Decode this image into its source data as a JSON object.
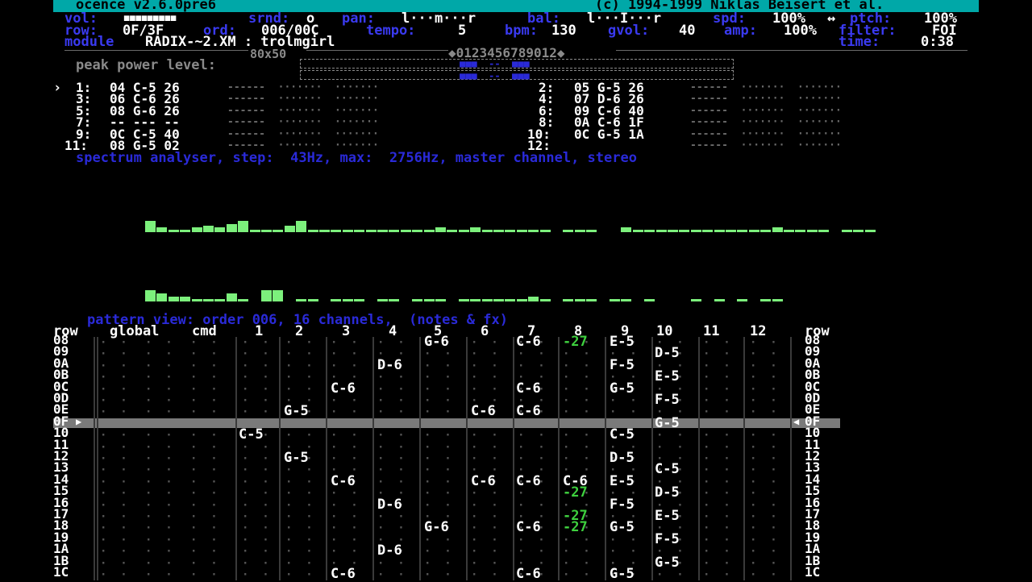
{
  "title": {
    "app": "ocence v2.6.0pre6",
    "copyright": "(c) 1994-1999 Niklas Beisert et al."
  },
  "status": {
    "vol_label": "vol:",
    "vol_value": "▪▪▪▪▪▪▪▪▪",
    "srnd_label": "srnd:",
    "srnd_value": "o",
    "pan_label": "pan:",
    "pan_value": "l···m···r",
    "bal_label": "bal:",
    "bal_value": "l···I···r",
    "spd_label": "spd:",
    "spd_value": "100%",
    "ptch_label": "ptch:",
    "ptch_value": "100%",
    "row_label": "row:",
    "row_value": "0F/3F",
    "ord_label": "ord:",
    "ord_value": "006/00C",
    "tempo_label": "tempo:",
    "tempo_value": "5",
    "bpm_label": "bpm:",
    "bpm_value": "130",
    "gvol_label": "gvol:",
    "gvol_value": "40",
    "amp_label": "amp:",
    "amp_value": "100%",
    "filter_label": "filter:",
    "filter_value": "FOI",
    "module_label": "module",
    "module_value": "RADIX-~2.XM : trolmgirl",
    "time_label": "time:",
    "time_value": "0:38"
  },
  "mode_box": "80x50",
  "channel_scale": "◆0123456789012◆",
  "peak_label": "peak power level:",
  "channels_left": [
    {
      "num": "1:",
      "note": "04 C-5 26",
      "selected": true
    },
    {
      "num": "3:",
      "note": "06 C-6 26"
    },
    {
      "num": "5:",
      "note": "08 G-6 26"
    },
    {
      "num": "7:",
      "note": "-- --- --"
    },
    {
      "num": "9:",
      "note": "0C C-5 40"
    },
    {
      "num": "11:",
      "note": "08 G-5 02"
    }
  ],
  "channels_right": [
    {
      "num": "2:",
      "note": "05 G-5 26"
    },
    {
      "num": "4:",
      "note": "07 D-6 26"
    },
    {
      "num": "6:",
      "note": "09 C-6 40"
    },
    {
      "num": "8:",
      "note": "0A C-6 1F"
    },
    {
      "num": "10:",
      "note": "0C G-5 1A"
    },
    {
      "num": "12:",
      "note": ""
    }
  ],
  "spectrum_title": "spectrum analyser, step:  43Hz, max:  2756Hz, master channel, stereo",
  "pattern_title": "pattern view: order 006, 16 channels,  (notes & fx)",
  "pattern_header": {
    "row": "row",
    "global": "global",
    "cmd": "cmd",
    "cols": [
      "1",
      "2",
      "3",
      "4",
      "5",
      "6",
      "7",
      "8",
      "9",
      "10",
      "11",
      "12"
    ],
    "row_right": "row"
  },
  "rows": [
    "08",
    "09",
    "0A",
    "0B",
    "0C",
    "0D",
    "0E",
    "0F",
    "10",
    "11",
    "12",
    "13",
    "14",
    "15",
    "16",
    "17",
    "18",
    "19",
    "1A",
    "1B",
    "1C"
  ],
  "notes": {
    "gs5": "G-5",
    "cs5": "C-5",
    "cs6": "C-6",
    "ds5": "D-5",
    "ds6": "D-6",
    "es5": "E-5",
    "fs5": "F-5",
    "gs6": "G-6",
    "fx27": "-27"
  },
  "spectrum": {
    "top": [
      14,
      6,
      3,
      3,
      6,
      8,
      6,
      10,
      14,
      3,
      3,
      3,
      8,
      14,
      3,
      3,
      3,
      3,
      3,
      3,
      3,
      3,
      3,
      3,
      3,
      6,
      3,
      3,
      6,
      3,
      3,
      3,
      3,
      3,
      3,
      0,
      3,
      3,
      3,
      0,
      0,
      6,
      3,
      3,
      3,
      3,
      3,
      3,
      3,
      3,
      3,
      3,
      3,
      3,
      6,
      3,
      3,
      3,
      3,
      0,
      3,
      3,
      3
    ],
    "bottom": [
      14,
      10,
      6,
      6,
      3,
      3,
      3,
      10,
      3,
      0,
      14,
      14,
      0,
      3,
      3,
      0,
      3,
      3,
      3,
      0,
      3,
      3,
      0,
      3,
      3,
      3,
      0,
      3,
      3,
      3,
      3,
      3,
      3,
      6,
      3,
      0,
      3,
      3,
      3,
      0,
      3,
      3,
      0,
      3,
      0,
      0,
      0,
      3,
      0,
      3,
      0,
      3,
      0,
      3,
      3
    ]
  },
  "colors": {
    "accent": "#00a8a8",
    "label": "#3a3af0",
    "spectrum": "#7cf07c",
    "fx": "#3ed03e",
    "highlight": "#7a7a7a"
  }
}
